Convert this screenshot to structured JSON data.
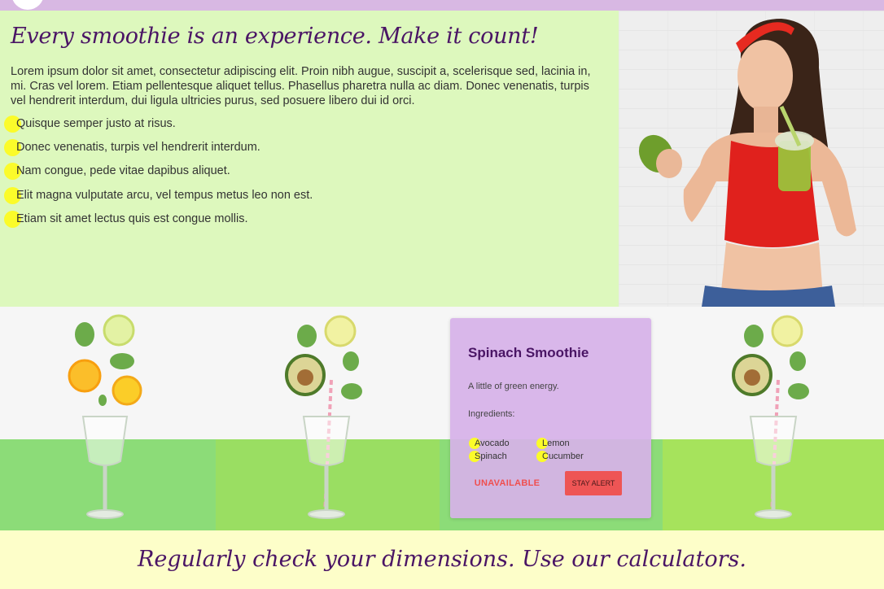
{
  "hero": {
    "title": "Every smoothie is an experience. Make it count!",
    "paragraph": "Lorem ipsum dolor sit amet, consectetur adipiscing elit. Proin nibh augue, suscipit a, scelerisque sed, lacinia in, mi. Cras vel lorem. Etiam pellentesque aliquet tellus. Phasellus pharetra nulla ac diam. Donec venenatis, turpis vel hendrerit interdum, dui ligula ultricies purus, sed posuere libero dui id orci.",
    "list": [
      "Quisque semper justo at risus.",
      "Donec venenatis, turpis vel hendrerit interdum.",
      "Nam congue, pede vitae dapibus aliquet.",
      "Elit magna vulputate arcu, vel tempus metus leo non est.",
      "Etiam sit amet lectus quis est congue mollis."
    ]
  },
  "card": {
    "title": "Spinach Smoothie",
    "description": "A little of green energy.",
    "ingredients_label": "Ingredients:",
    "ingredients": [
      "Avocado",
      "Lemon",
      "Spinach",
      "Cucumber"
    ],
    "unavailable_label": "UNAVAILABLE",
    "alert_label": "STAY ALERT"
  },
  "footer": {
    "title": "Regularly check your dimensions. Use our calculators."
  },
  "colors": {
    "accent_purple": "#4a1565",
    "bullet_yellow": "#fbfb2a",
    "hero_bg": "#ddf8bd",
    "card_bg": "#d6b2e8",
    "alert_red": "#ee5555",
    "footer_bg": "#fdfec9",
    "topbar": "#d8b8e3"
  }
}
